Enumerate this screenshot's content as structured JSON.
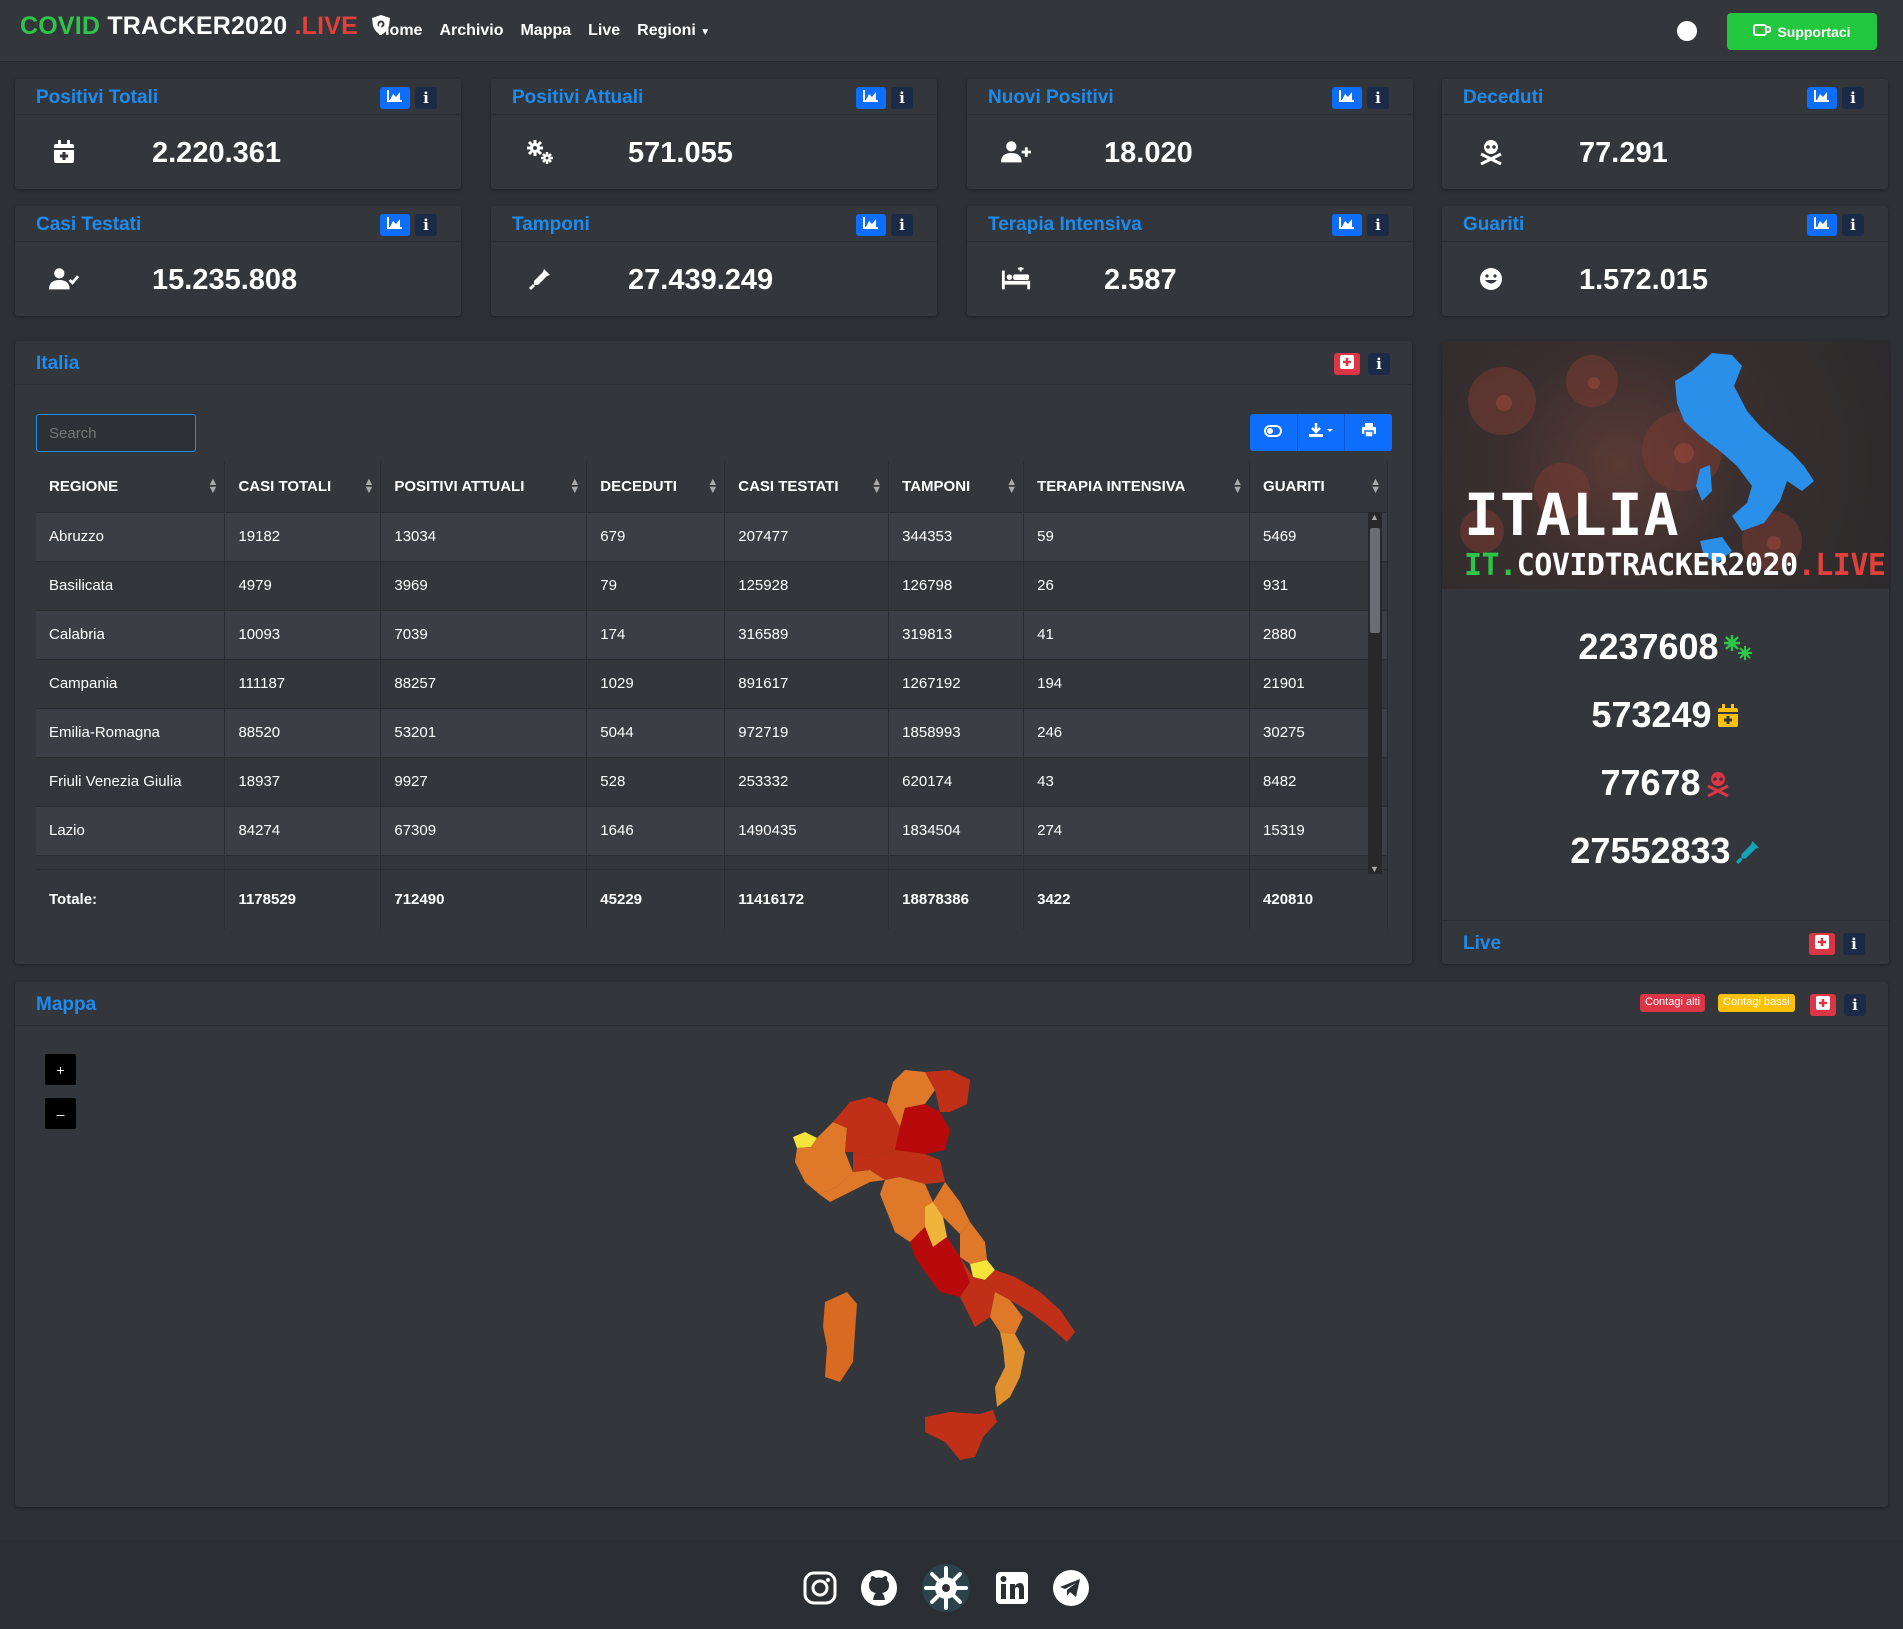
{
  "brand": {
    "part1": "COVID",
    "part2": " TRACKER2020",
    "part3": ".LIVE"
  },
  "nav": {
    "home": "Home",
    "archivio": "Archivio",
    "mappa": "Mappa",
    "live": "Live",
    "regioni": "Regioni"
  },
  "support": {
    "label": "Supportaci"
  },
  "stats": [
    {
      "title": "Positivi Totali",
      "value": "2.220.361",
      "icon": "calendar-plus-icon"
    },
    {
      "title": "Positivi Attuali",
      "value": "571.055",
      "icon": "gears-icon"
    },
    {
      "title": "Nuovi Positivi",
      "value": "18.020",
      "icon": "user-plus-icon"
    },
    {
      "title": "Deceduti",
      "value": "77.291",
      "icon": "skull-crossbones-icon"
    },
    {
      "title": "Casi Testati",
      "value": "15.235.808",
      "icon": "user-check-icon"
    },
    {
      "title": "Tamponi",
      "value": "27.439.249",
      "icon": "syringe-icon"
    },
    {
      "title": "Terapia Intensiva",
      "value": "2.587",
      "icon": "hospital-bed-icon"
    },
    {
      "title": "Guariti",
      "value": "1.572.015",
      "icon": "smile-icon"
    }
  ],
  "italia": {
    "title": "Italia",
    "search_placeholder": "Search",
    "columns": [
      "REGIONE",
      "CASI TOTALI",
      "POSITIVI ATTUALI",
      "DECEDUTI",
      "CASI TESTATI",
      "TAMPONI",
      "TERAPIA INTENSIVA",
      "GUARITI"
    ],
    "rows": [
      [
        "Abruzzo",
        "19182",
        "13034",
        "679",
        "207477",
        "344353",
        "59",
        "5469"
      ],
      [
        "Basilicata",
        "4979",
        "3969",
        "79",
        "125928",
        "126798",
        "26",
        "931"
      ],
      [
        "Calabria",
        "10093",
        "7039",
        "174",
        "316589",
        "319813",
        "41",
        "2880"
      ],
      [
        "Campania",
        "111187",
        "88257",
        "1029",
        "891617",
        "1267192",
        "194",
        "21901"
      ],
      [
        "Emilia-Romagna",
        "88520",
        "53201",
        "5044",
        "972719",
        "1858993",
        "246",
        "30275"
      ],
      [
        "Friuli Venezia Giulia",
        "18937",
        "9927",
        "528",
        "253332",
        "620174",
        "43",
        "8482"
      ],
      [
        "Lazio",
        "84274",
        "67309",
        "1646",
        "1490435",
        "1834504",
        "274",
        "15319"
      ]
    ],
    "totals": [
      "Totale:",
      "1178529",
      "712490",
      "45229",
      "11416172",
      "18878386",
      "3422",
      "420810"
    ]
  },
  "live": {
    "banner_title": "ITALIA",
    "banner_sub_prefix": "IT.",
    "banner_sub_main": "COVIDTRACKER2020",
    "banner_sub_suffix": ".LIVE",
    "numbers": [
      {
        "value": "2237608",
        "icon": "virus-icon",
        "color": "#2ec44a"
      },
      {
        "value": "573249",
        "icon": "calendar-plus-icon",
        "color": "#ffc107"
      },
      {
        "value": "77678",
        "icon": "skull-crossbones-icon",
        "color": "#dc3545"
      },
      {
        "value": "27552833",
        "icon": "syringe-icon",
        "color": "#17a2b8"
      }
    ],
    "footer_title": "Live"
  },
  "mappa": {
    "title": "Mappa",
    "legend_high": "Contagi alti",
    "legend_low": "Contagi bassi",
    "zoom_in": "+",
    "zoom_out": "–"
  },
  "footer": {
    "icons": [
      "instagram-icon",
      "github-icon",
      "virus-icon",
      "linkedin-icon",
      "telegram-icon"
    ]
  },
  "colors": {
    "accent": "#1d8cf0",
    "primary": "#0d6efd",
    "danger": "#dc3545",
    "success": "#22c73f",
    "warning": "#ffc107",
    "bg": "#2d3035",
    "card": "#33363b"
  }
}
